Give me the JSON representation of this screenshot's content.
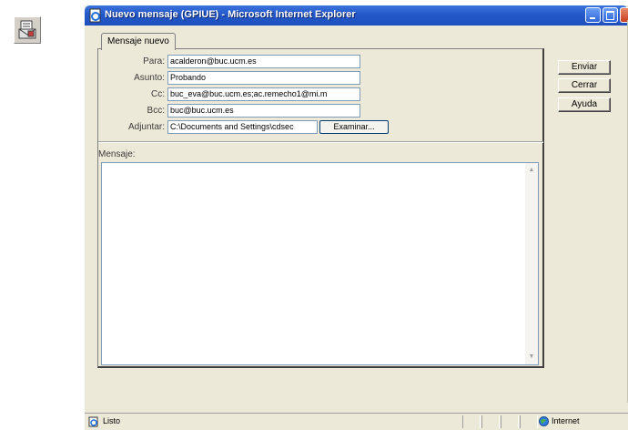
{
  "window": {
    "title": "Nuevo mensaje (GPIUE) - Microsoft Internet Explorer"
  },
  "tab": {
    "label": "Mensaje nuevo"
  },
  "form": {
    "fields": [
      {
        "label": "Para:",
        "value": "acalderon@buc.ucm.es"
      },
      {
        "label": "Asunto:",
        "value": "Probando"
      },
      {
        "label": "Cc:",
        "value": "buc_eva@buc.ucm.es;ac.remecho1@mi.m"
      },
      {
        "label": "Bcc:",
        "value": "buc@buc.ucm.es"
      },
      {
        "label": "Adjuntar:",
        "value": "C:\\Documents and Settings\\cdsec"
      }
    ],
    "browse_label": "Examinar...",
    "message_label": "Mensaje:",
    "message_value": ""
  },
  "actions": {
    "send": "Enviar",
    "close": "Cerrar",
    "help": "Ayuda"
  },
  "statusbar": {
    "status": "Listo",
    "zone": "Internet"
  },
  "icons": {
    "app": "compose-message-icon",
    "window": "ie-page-icon",
    "status": "page-icon",
    "zone": "globe-icon"
  }
}
